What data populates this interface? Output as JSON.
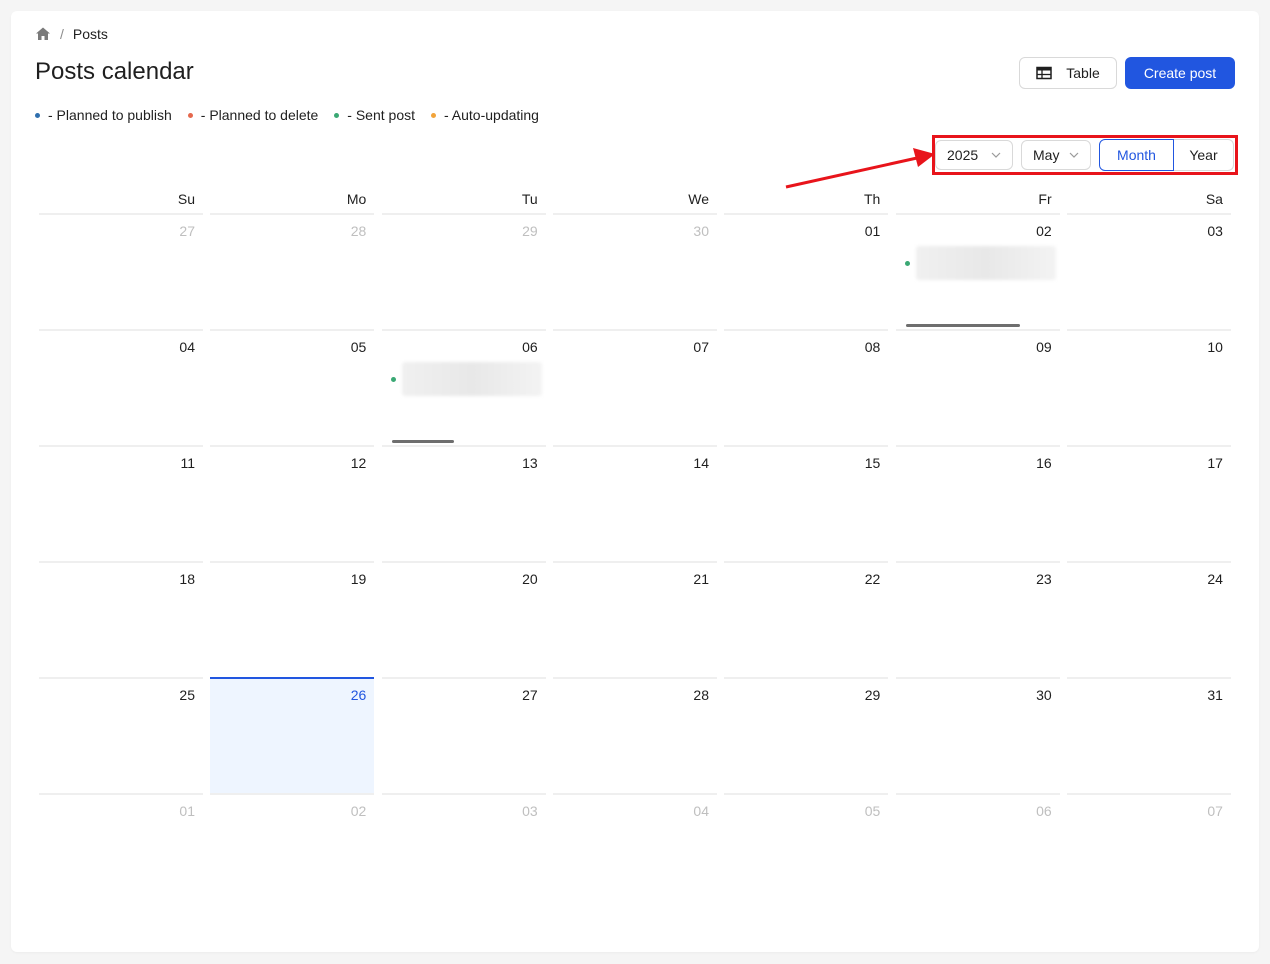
{
  "breadcrumb": {
    "home_icon": "home-icon",
    "separator": "/",
    "current": "Posts"
  },
  "page": {
    "title": "Posts calendar"
  },
  "toolbar": {
    "table_label": "Table",
    "table_icon": "table-icon",
    "create_label": "Create post"
  },
  "legend": [
    {
      "label": "- Planned to publish",
      "color": "#2f6fae"
    },
    {
      "label": "- Planned to delete",
      "color": "#e5684d"
    },
    {
      "label": "- Sent post",
      "color": "#3aa874"
    },
    {
      "label": "- Auto-updating",
      "color": "#f2a43a"
    }
  ],
  "controls": {
    "year": "2025",
    "month": "May",
    "view_month": "Month",
    "view_year": "Year",
    "active_view": "Month",
    "highlight_color": "#e8141b"
  },
  "calendar": {
    "weekdays": [
      "Su",
      "Mo",
      "Tu",
      "We",
      "Th",
      "Fr",
      "Sa"
    ],
    "weeks": [
      [
        "27",
        "28",
        "29",
        "30",
        "01",
        "02",
        "03"
      ],
      [
        "04",
        "05",
        "06",
        "07",
        "08",
        "09",
        "10"
      ],
      [
        "11",
        "12",
        "13",
        "14",
        "15",
        "16",
        "17"
      ],
      [
        "18",
        "19",
        "20",
        "21",
        "22",
        "23",
        "24"
      ],
      [
        "25",
        "26",
        "27",
        "28",
        "29",
        "30",
        "31"
      ],
      [
        "01",
        "02",
        "03",
        "04",
        "05",
        "06",
        "07"
      ]
    ],
    "today": "26",
    "accent_color": "#2156e0",
    "sent_color": "#3aa874"
  }
}
